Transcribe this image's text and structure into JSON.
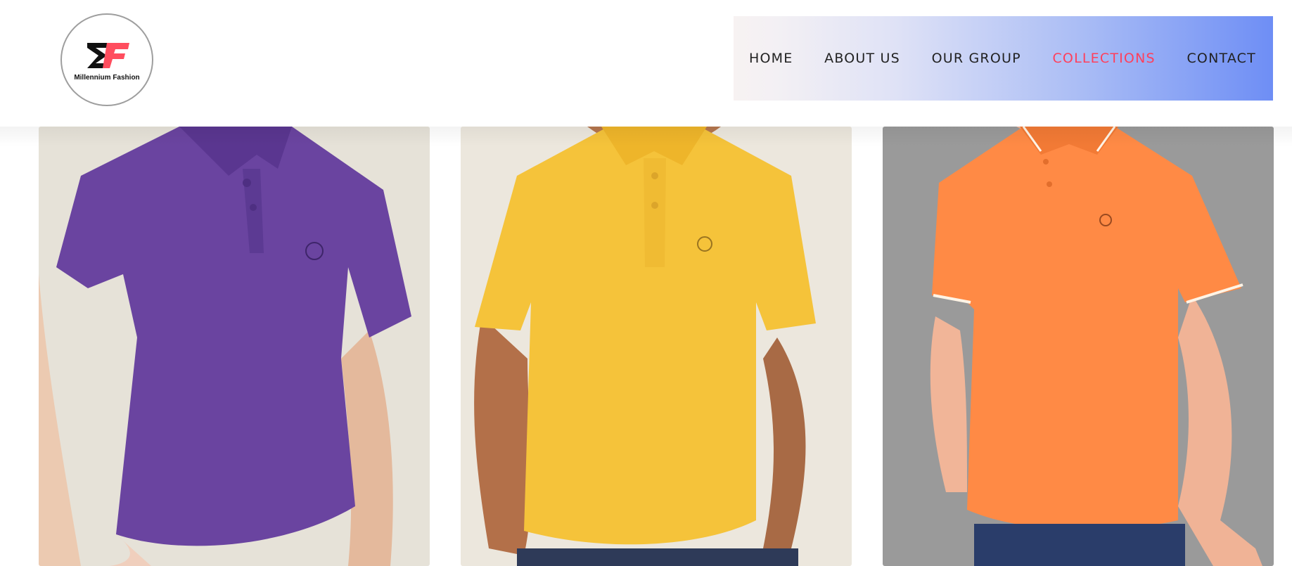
{
  "brand": {
    "logo_text": "Millennium Fashion",
    "logo_mark_letters": "MF",
    "colors": {
      "mark_dark": "#111111",
      "mark_accent": "#ff4d5e"
    }
  },
  "nav": {
    "items": [
      {
        "label": "HOME",
        "active": false
      },
      {
        "label": "ABOUT US",
        "active": false
      },
      {
        "label": "OUR GROUP",
        "active": false
      },
      {
        "label": "COLLECTIONS",
        "active": true
      },
      {
        "label": "CONTACT",
        "active": false
      }
    ],
    "active_color": "#ff3f5b",
    "gradient": [
      "#f7f2f2",
      "#6e8ef5"
    ]
  },
  "products": [
    {
      "image": "purple-polo-shirt",
      "shirt_color": "#6a44a0",
      "background": "#e6e2d8"
    },
    {
      "image": "yellow-polo-shirt",
      "shirt_color": "#f5c33a",
      "background": "#ece7dd"
    },
    {
      "image": "orange-polo-shirt",
      "shirt_color": "#ff8a45",
      "background": "#9a9a9a"
    }
  ]
}
